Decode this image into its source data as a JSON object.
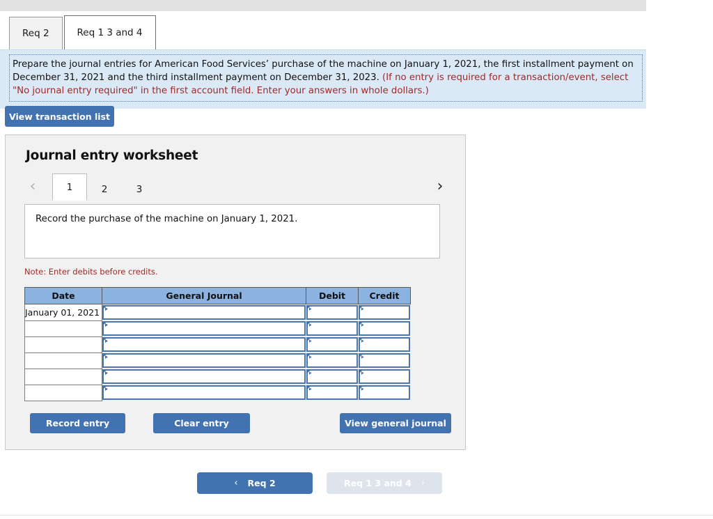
{
  "req_tabs": [
    {
      "label": "Req 2",
      "active": false
    },
    {
      "label": "Req 1 3 and 4",
      "active": true
    }
  ],
  "instructions": {
    "black_text": "Prepare the journal entries for American Food Services’ purchase of the machine on January 1, 2021, the first installment payment on December 31, 2021 and the third installment payment on December 31, 2023. ",
    "red_text": "(If no entry is required for a transaction/event, select \"No journal entry required\" in the first account field. Enter your answers in whole dollars.)"
  },
  "toolbar": {
    "view_transaction_list_label": "View transaction list"
  },
  "worksheet": {
    "title": "Journal entry worksheet",
    "pager": {
      "prev_icon": "chevron-left-icon",
      "next_icon": "chevron-right-icon",
      "pages": [
        {
          "label": "1",
          "active": true
        },
        {
          "label": "2",
          "active": false
        },
        {
          "label": "3",
          "active": false
        }
      ]
    },
    "description": "Record the purchase of the machine on January 1, 2021.",
    "note": "Note: Enter debits before credits.",
    "table": {
      "columns": [
        "Date",
        "General Journal",
        "Debit",
        "Credit"
      ],
      "rows": [
        {
          "date": "January 01, 2021",
          "general_journal": "",
          "debit": "",
          "credit": ""
        },
        {
          "date": "",
          "general_journal": "",
          "debit": "",
          "credit": ""
        },
        {
          "date": "",
          "general_journal": "",
          "debit": "",
          "credit": ""
        },
        {
          "date": "",
          "general_journal": "",
          "debit": "",
          "credit": ""
        },
        {
          "date": "",
          "general_journal": "",
          "debit": "",
          "credit": ""
        },
        {
          "date": "",
          "general_journal": "",
          "debit": "",
          "credit": ""
        }
      ]
    },
    "actions": {
      "record_entry_label": "Record entry",
      "clear_entry_label": "Clear entry",
      "view_general_journal_label": "View general journal"
    }
  },
  "bottom_nav": {
    "prev_label": "Req 2",
    "prev_icon": "chevron-left-icon",
    "next_label": "Req 1 3 and 4",
    "next_icon": "chevron-right-icon",
    "next_disabled": true
  },
  "colors": {
    "button_blue": "#4272b0",
    "table_header_blue": "#8cb3e0",
    "field_border_blue": "#4b77ac",
    "instruction_bg": "#dbe9f7",
    "red_text": "#9e2a28",
    "card_bg": "#f1f1f1",
    "disabled_nav": "#dde4ec"
  }
}
